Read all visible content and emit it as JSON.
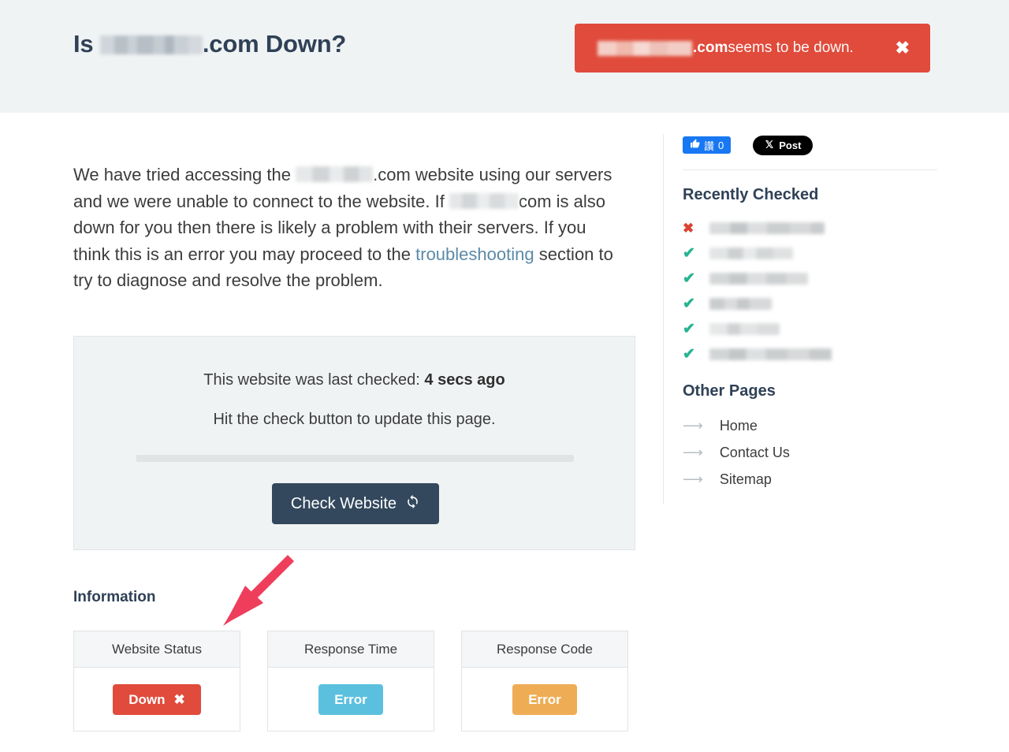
{
  "header": {
    "title_prefix": "Is",
    "title_suffix": ".com Down?",
    "domain_redacted": "",
    "alert": {
      "domain_redacted": "",
      "strong": ".com",
      "rest": " seems to be down.",
      "close_label": "✖"
    }
  },
  "main": {
    "intro": {
      "part1": "We have tried accessing the",
      "part2": ".com website using our servers and we were unable to connect to the website. If",
      "part3": "com is also down for you then there is likely a problem with their servers. If you think this is an error you may proceed to the",
      "link": "troubleshooting",
      "part4": "section to try to diagnose and resolve the problem."
    },
    "check_panel": {
      "last_checked_prefix": "This website was last checked:",
      "last_checked_value": "4 secs ago",
      "hint": "Hit the check button to update this page.",
      "progress_percent": 0,
      "button_label": "Check Website",
      "button_icon": "refresh-icon"
    },
    "information": {
      "heading": "Information",
      "cards": [
        {
          "title": "Website Status",
          "badge_label": "Down",
          "badge_icon": "✖",
          "badge_color": "#e04b3b",
          "badge_style": "badge-down"
        },
        {
          "title": "Response Time",
          "badge_label": "Error",
          "badge_icon": "",
          "badge_color": "#5bc0de",
          "badge_style": "badge-blue"
        },
        {
          "title": "Response Code",
          "badge_label": "Error",
          "badge_icon": "",
          "badge_color": "#eead55",
          "badge_style": "badge-orange"
        }
      ]
    },
    "annotation": {
      "type": "arrow",
      "color": "#ef3e5c",
      "points_to": "Website Status"
    }
  },
  "sidebar": {
    "social": {
      "facebook_label": "讚",
      "facebook_count": "0",
      "x_label": "Post"
    },
    "recently_checked": {
      "heading": "Recently Checked",
      "items": [
        {
          "status": "down",
          "mark": "✖",
          "redact_class": "rs1"
        },
        {
          "status": "up",
          "mark": "✔",
          "redact_class": "rs2"
        },
        {
          "status": "up",
          "mark": "✔",
          "redact_class": "rs3"
        },
        {
          "status": "up",
          "mark": "✔",
          "redact_class": "rs4"
        },
        {
          "status": "up",
          "mark": "✔",
          "redact_class": "rs5"
        },
        {
          "status": "up",
          "mark": "✔",
          "redact_class": "rs6"
        }
      ]
    },
    "other_pages": {
      "heading": "Other Pages",
      "items": [
        {
          "label": "Home"
        },
        {
          "label": "Contact Us"
        },
        {
          "label": "Sitemap"
        }
      ]
    }
  },
  "colors": {
    "header_bg": "#f0f3f4",
    "title": "#2f4156",
    "alert_red": "#e04b3b",
    "button_navy": "#33485d",
    "link_blue": "#5b8aa8",
    "check_green": "#27b392",
    "cross_red": "#d9432f",
    "annotation_pink": "#ef3e5c"
  }
}
